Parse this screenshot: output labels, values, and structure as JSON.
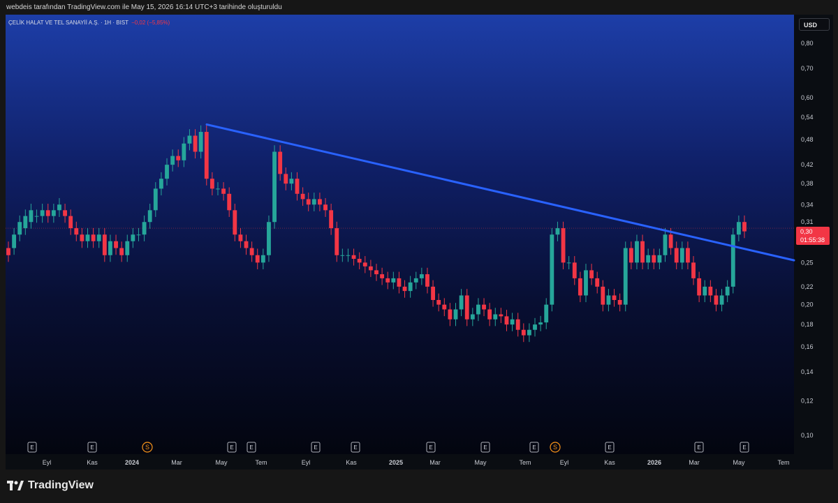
{
  "header": {
    "text": "webdeis tarafından TradingView.com ile May 15, 2026 16:14 UTC+3 tarihinde oluşturuldu"
  },
  "legend": {
    "symbol": "ÇELİK HALAT VE TEL SANAYİİ A.Ş. · 1H · BIST",
    "change": "−0,02 (−5,85%)"
  },
  "currency": "USD",
  "price_tag": {
    "price": "0,30",
    "countdown": "01:55:38"
  },
  "brand": {
    "name": "TradingView"
  },
  "colors": {
    "up": "#26a69a",
    "down": "#f23645",
    "trendline": "#2962ff",
    "accent_orange": "#f7931a",
    "accent_purple": "#9c27b0"
  },
  "chart_data": {
    "type": "candlestick",
    "scale": "log",
    "y_ticks": [
      "0,80",
      "0,70",
      "0,60",
      "0,54",
      "0,48",
      "0,42",
      "0,38",
      "0,34",
      "0,31",
      "0,25",
      "0,22",
      "0,20",
      "0,18",
      "0,16",
      "0,14",
      "0,12",
      "0,10"
    ],
    "y_tick_values": [
      0.8,
      0.7,
      0.6,
      0.54,
      0.48,
      0.42,
      0.38,
      0.34,
      0.31,
      0.25,
      0.22,
      0.2,
      0.18,
      0.16,
      0.14,
      0.12,
      0.1
    ],
    "x_ticks": [
      "Eyl",
      "Kas",
      "2024",
      "Mar",
      "May",
      "Tem",
      "Eyl",
      "Kas",
      "2025",
      "Mar",
      "May",
      "Tem",
      "Eyl",
      "Kas",
      "2026",
      "Mar",
      "May",
      "Tem"
    ],
    "current_price": 0.3,
    "event_markers": [
      "E",
      "E",
      "S",
      "E",
      "E",
      "E",
      "E",
      "E",
      "E",
      "E",
      "S",
      "E",
      "E",
      "E",
      "⚡"
    ],
    "candles": [
      {
        "o": 0.27,
        "c": 0.26
      },
      {
        "o": 0.27,
        "c": 0.29
      },
      {
        "o": 0.29,
        "c": 0.31
      },
      {
        "o": 0.3,
        "c": 0.32
      },
      {
        "o": 0.31,
        "c": 0.33
      },
      {
        "o": 0.32,
        "c": 0.32
      },
      {
        "o": 0.32,
        "c": 0.33
      },
      {
        "o": 0.33,
        "c": 0.32
      },
      {
        "o": 0.32,
        "c": 0.33
      },
      {
        "o": 0.33,
        "c": 0.34
      },
      {
        "o": 0.33,
        "c": 0.32
      },
      {
        "o": 0.32,
        "c": 0.3
      },
      {
        "o": 0.3,
        "c": 0.29
      },
      {
        "o": 0.29,
        "c": 0.28
      },
      {
        "o": 0.28,
        "c": 0.29
      },
      {
        "o": 0.29,
        "c": 0.28
      },
      {
        "o": 0.28,
        "c": 0.29
      },
      {
        "o": 0.29,
        "c": 0.26
      },
      {
        "o": 0.26,
        "c": 0.28
      },
      {
        "o": 0.28,
        "c": 0.27
      },
      {
        "o": 0.27,
        "c": 0.26
      },
      {
        "o": 0.26,
        "c": 0.28
      },
      {
        "o": 0.28,
        "c": 0.29
      },
      {
        "o": 0.29,
        "c": 0.29
      },
      {
        "o": 0.29,
        "c": 0.31
      },
      {
        "o": 0.31,
        "c": 0.33
      },
      {
        "o": 0.33,
        "c": 0.37
      },
      {
        "o": 0.37,
        "c": 0.39
      },
      {
        "o": 0.39,
        "c": 0.42
      },
      {
        "o": 0.42,
        "c": 0.44
      },
      {
        "o": 0.44,
        "c": 0.43
      },
      {
        "o": 0.43,
        "c": 0.47
      },
      {
        "o": 0.47,
        "c": 0.49
      },
      {
        "o": 0.49,
        "c": 0.45
      },
      {
        "o": 0.45,
        "c": 0.5
      },
      {
        "o": 0.5,
        "c": 0.39
      },
      {
        "o": 0.39,
        "c": 0.37
      },
      {
        "o": 0.37,
        "c": 0.37
      },
      {
        "o": 0.37,
        "c": 0.36
      },
      {
        "o": 0.36,
        "c": 0.33
      },
      {
        "o": 0.33,
        "c": 0.29
      },
      {
        "o": 0.29,
        "c": 0.28
      },
      {
        "o": 0.28,
        "c": 0.27
      },
      {
        "o": 0.27,
        "c": 0.26
      },
      {
        "o": 0.26,
        "c": 0.25
      },
      {
        "o": 0.25,
        "c": 0.26
      },
      {
        "o": 0.26,
        "c": 0.31
      },
      {
        "o": 0.31,
        "c": 0.45
      },
      {
        "o": 0.45,
        "c": 0.4
      },
      {
        "o": 0.4,
        "c": 0.38
      },
      {
        "o": 0.38,
        "c": 0.39
      },
      {
        "o": 0.39,
        "c": 0.36
      },
      {
        "o": 0.36,
        "c": 0.35
      },
      {
        "o": 0.35,
        "c": 0.34
      },
      {
        "o": 0.34,
        "c": 0.35
      },
      {
        "o": 0.35,
        "c": 0.34
      },
      {
        "o": 0.34,
        "c": 0.33
      },
      {
        "o": 0.33,
        "c": 0.3
      },
      {
        "o": 0.3,
        "c": 0.26
      },
      {
        "o": 0.26,
        "c": 0.26
      },
      {
        "o": 0.26,
        "c": 0.26
      },
      {
        "o": 0.26,
        "c": 0.255
      },
      {
        "o": 0.255,
        "c": 0.25
      },
      {
        "o": 0.25,
        "c": 0.245
      },
      {
        "o": 0.245,
        "c": 0.24
      },
      {
        "o": 0.24,
        "c": 0.235
      },
      {
        "o": 0.235,
        "c": 0.23
      },
      {
        "o": 0.23,
        "c": 0.225
      },
      {
        "o": 0.225,
        "c": 0.23
      },
      {
        "o": 0.23,
        "c": 0.22
      },
      {
        "o": 0.22,
        "c": 0.215
      },
      {
        "o": 0.215,
        "c": 0.225
      },
      {
        "o": 0.225,
        "c": 0.23
      },
      {
        "o": 0.23,
        "c": 0.235
      },
      {
        "o": 0.235,
        "c": 0.22
      },
      {
        "o": 0.22,
        "c": 0.205
      },
      {
        "o": 0.205,
        "c": 0.2
      },
      {
        "o": 0.2,
        "c": 0.195
      },
      {
        "o": 0.195,
        "c": 0.185
      },
      {
        "o": 0.185,
        "c": 0.195
      },
      {
        "o": 0.195,
        "c": 0.21
      },
      {
        "o": 0.21,
        "c": 0.185
      },
      {
        "o": 0.185,
        "c": 0.19
      },
      {
        "o": 0.19,
        "c": 0.2
      },
      {
        "o": 0.2,
        "c": 0.195
      },
      {
        "o": 0.195,
        "c": 0.185
      },
      {
        "o": 0.185,
        "c": 0.19
      },
      {
        "o": 0.19,
        "c": 0.188
      },
      {
        "o": 0.188,
        "c": 0.18
      },
      {
        "o": 0.18,
        "c": 0.185
      },
      {
        "o": 0.185,
        "c": 0.175
      },
      {
        "o": 0.175,
        "c": 0.17
      },
      {
        "o": 0.17,
        "c": 0.175
      },
      {
        "o": 0.175,
        "c": 0.18
      },
      {
        "o": 0.18,
        "c": 0.182
      },
      {
        "o": 0.182,
        "c": 0.2
      },
      {
        "o": 0.2,
        "c": 0.29
      },
      {
        "o": 0.29,
        "c": 0.3
      },
      {
        "o": 0.3,
        "c": 0.25
      },
      {
        "o": 0.25,
        "c": 0.25
      },
      {
        "o": 0.25,
        "c": 0.23
      },
      {
        "o": 0.23,
        "c": 0.21
      },
      {
        "o": 0.21,
        "c": 0.24
      },
      {
        "o": 0.24,
        "c": 0.23
      },
      {
        "o": 0.23,
        "c": 0.22
      },
      {
        "o": 0.22,
        "c": 0.2
      },
      {
        "o": 0.2,
        "c": 0.21
      },
      {
        "o": 0.21,
        "c": 0.205
      },
      {
        "o": 0.205,
        "c": 0.2
      },
      {
        "o": 0.2,
        "c": 0.27
      },
      {
        "o": 0.27,
        "c": 0.25
      },
      {
        "o": 0.25,
        "c": 0.28
      },
      {
        "o": 0.28,
        "c": 0.25
      },
      {
        "o": 0.25,
        "c": 0.26
      },
      {
        "o": 0.26,
        "c": 0.25
      },
      {
        "o": 0.25,
        "c": 0.26
      },
      {
        "o": 0.26,
        "c": 0.29
      },
      {
        "o": 0.29,
        "c": 0.27
      },
      {
        "o": 0.27,
        "c": 0.25
      },
      {
        "o": 0.25,
        "c": 0.27
      },
      {
        "o": 0.27,
        "c": 0.25
      },
      {
        "o": 0.25,
        "c": 0.23
      },
      {
        "o": 0.23,
        "c": 0.21
      },
      {
        "o": 0.21,
        "c": 0.22
      },
      {
        "o": 0.22,
        "c": 0.21
      },
      {
        "o": 0.21,
        "c": 0.2
      },
      {
        "o": 0.2,
        "c": 0.21
      },
      {
        "o": 0.21,
        "c": 0.22
      },
      {
        "o": 0.22,
        "c": 0.29
      },
      {
        "o": 0.29,
        "c": 0.31
      },
      {
        "o": 0.31,
        "c": 0.295
      }
    ],
    "trendline": {
      "start_value": 0.52,
      "end_value": 0.253
    }
  }
}
